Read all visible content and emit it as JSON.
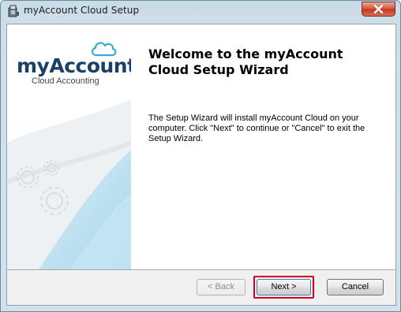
{
  "window": {
    "title": "myAccount Cloud Setup"
  },
  "sidebar": {
    "logo_main": "myAccount",
    "logo_sub": "Cloud Accounting"
  },
  "content": {
    "heading": "Welcome to the myAccount Cloud Setup Wizard",
    "description": "The Setup Wizard will install myAccount Cloud on your computer.  Click \"Next\" to continue or \"Cancel\" to exit the Setup Wizard."
  },
  "buttons": {
    "back_label": "< Back",
    "next_label": "Next >",
    "cancel_label": "Cancel"
  },
  "colors": {
    "logo_text": "#1b3f66",
    "cloud_icon": "#3aa7d9",
    "highlight_border": "#d2001e",
    "close_button": "#c9452a"
  },
  "icons": {
    "app": "installer-icon",
    "close": "close-icon",
    "cloud": "cloud-icon",
    "gears": "gears-icon"
  }
}
